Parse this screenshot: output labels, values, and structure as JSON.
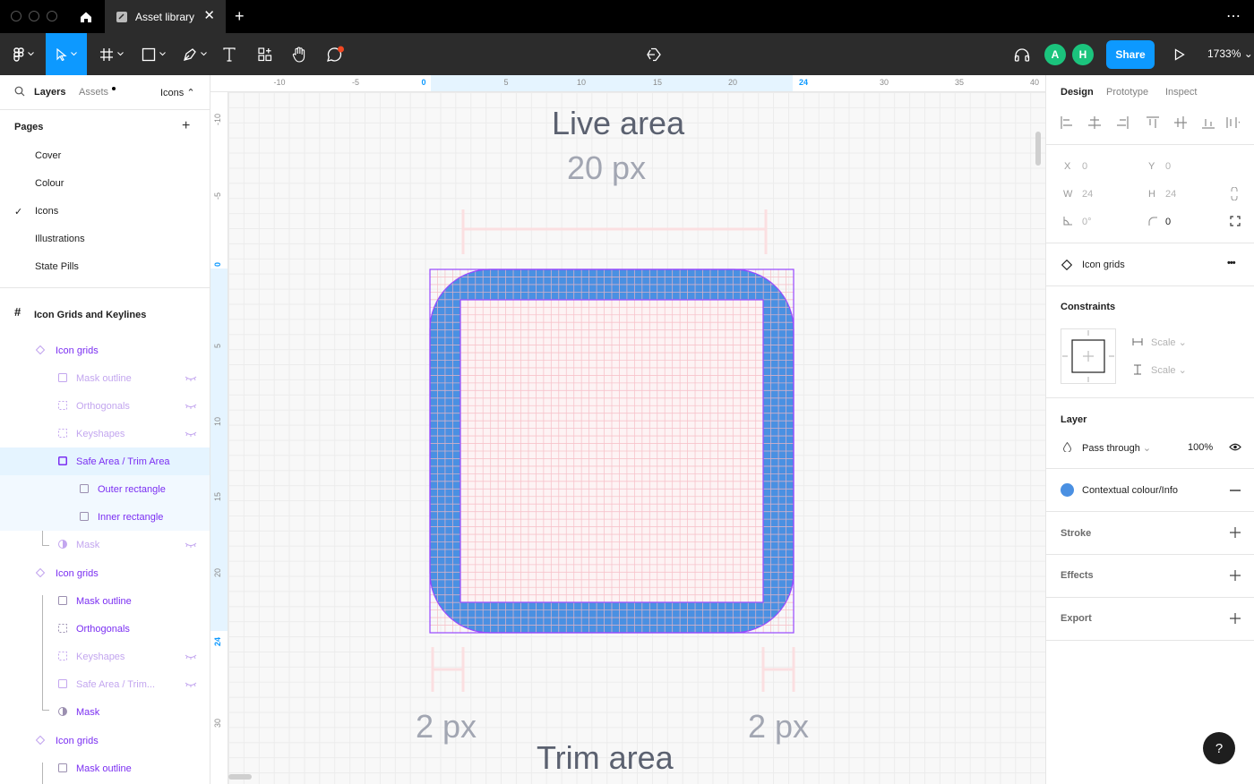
{
  "titlebar": {
    "file_tab": "Asset library",
    "close": "✕",
    "add_tab": "+",
    "more": "⋯"
  },
  "toolbar": {
    "share_label": "Share",
    "zoom": "1733%",
    "avatars": [
      "A",
      "H"
    ]
  },
  "left_panel": {
    "tabs": {
      "layers": "Layers",
      "assets": "Assets",
      "page_selector": "Icons ⌃"
    },
    "pages_title": "Pages",
    "pages_add": "+",
    "pages": [
      "Cover",
      "Colour",
      "Icons",
      "Illustrations",
      "State Pills"
    ],
    "current_page_check": "✓",
    "frame": {
      "icon": "#",
      "label": "Icon Grids and Keylines"
    },
    "layers": [
      {
        "label": "Icon grids"
      },
      {
        "label": "Mask outline"
      },
      {
        "label": "Orthogonals"
      },
      {
        "label": "Keyshapes"
      },
      {
        "label": "Safe Area / Trim Area"
      },
      {
        "label": "Outer rectangle"
      },
      {
        "label": "Inner rectangle"
      },
      {
        "label": "Mask"
      },
      {
        "label": "Icon grids"
      },
      {
        "label": "Mask outline"
      },
      {
        "label": "Orthogonals"
      },
      {
        "label": "Keyshapes"
      },
      {
        "label": "Safe Area / Trim..."
      },
      {
        "label": "Mask"
      },
      {
        "label": "Icon grids"
      },
      {
        "label": "Mask outline"
      }
    ]
  },
  "rulers": {
    "top": [
      "-10",
      "-5",
      "0",
      "5",
      "10",
      "15",
      "20",
      "24",
      "30",
      "35",
      "40"
    ],
    "left": [
      "-10",
      "-5",
      "0",
      "5",
      "10",
      "15",
      "20",
      "24",
      "30"
    ]
  },
  "canvas": {
    "live_area_title": "Live area",
    "live_area_size": "20 px",
    "left_margin": "2 px",
    "right_margin": "2 px",
    "trim_area_title": "Trim area",
    "fill_color": "#4a90e2",
    "selection_color": "#9747ff",
    "grid_color": "#f7c1c8"
  },
  "right_panel": {
    "tabs": [
      "Design",
      "Prototype",
      "Inspect"
    ],
    "x_label": "X",
    "x_value": "0",
    "y_label": "Y",
    "y_value": "0",
    "w_label": "W",
    "w_value": "24",
    "h_label": "H",
    "h_value": "24",
    "rotation_value": "0°",
    "radius_value": "0",
    "component_name": "Icon grids",
    "component_more": "•••",
    "constraints_title": "Constraints",
    "constraint_h": "Scale",
    "constraint_v": "Scale",
    "layer_title": "Layer",
    "blend_mode": "Pass through",
    "opacity": "100%",
    "fill_style_name": "Contextual colour/Info",
    "fill_color": "#4a90e2",
    "stroke_title": "Stroke",
    "effects_title": "Effects",
    "export_title": "Export",
    "help": "?"
  }
}
